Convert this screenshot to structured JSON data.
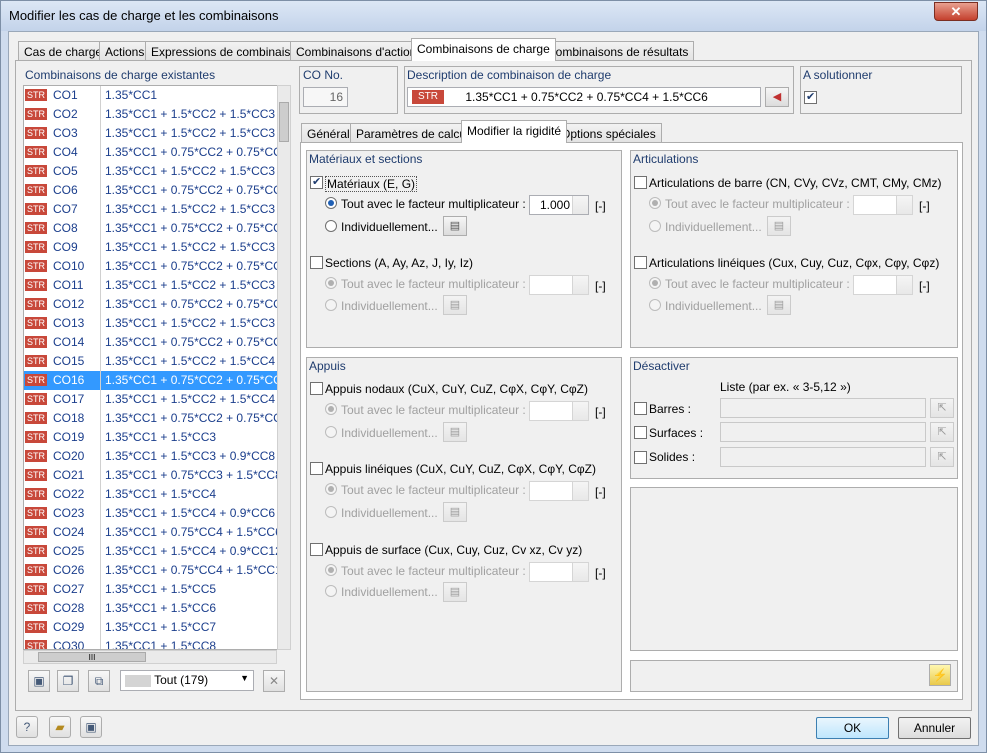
{
  "window": {
    "title": "Modifier les cas de charge et les combinaisons",
    "close": "✕"
  },
  "tabs": [
    "Cas de charge",
    "Actions",
    "Expressions de combinaison",
    "Combinaisons d'actions",
    "Combinaisons de charge",
    "Combinaisons de résultats"
  ],
  "list": {
    "title": "Combinaisons de charge existantes",
    "badge": "STR",
    "rows": [
      {
        "co": "CO1",
        "def": "1.35*CC1"
      },
      {
        "co": "CO2",
        "def": "1.35*CC1 + 1.5*CC2 + 1.5*CC3 + 1."
      },
      {
        "co": "CO3",
        "def": "1.35*CC1 + 1.5*CC2 + 1.5*CC3 + 1."
      },
      {
        "co": "CO4",
        "def": "1.35*CC1 + 0.75*CC2 + 0.75*CC3 +"
      },
      {
        "co": "CO5",
        "def": "1.35*CC1 + 1.5*CC2 + 1.5*CC3 + 1."
      },
      {
        "co": "CO6",
        "def": "1.35*CC1 + 0.75*CC2 + 0.75*CC3 +"
      },
      {
        "co": "CO7",
        "def": "1.35*CC1 + 1.5*CC2 + 1.5*CC3 + 1."
      },
      {
        "co": "CO8",
        "def": "1.35*CC1 + 0.75*CC2 + 0.75*CC3 +"
      },
      {
        "co": "CO9",
        "def": "1.35*CC1 + 1.5*CC2 + 1.5*CC3 + 1."
      },
      {
        "co": "CO10",
        "def": "1.35*CC1 + 0.75*CC2 + 0.75*CC3 +"
      },
      {
        "co": "CO11",
        "def": "1.35*CC1 + 1.5*CC2 + 1.5*CC3 + 1."
      },
      {
        "co": "CO12",
        "def": "1.35*CC1 + 0.75*CC2 + 0.75*CC3 +"
      },
      {
        "co": "CO13",
        "def": "1.35*CC1 + 1.5*CC2 + 1.5*CC3 + 0."
      },
      {
        "co": "CO14",
        "def": "1.35*CC1 + 0.75*CC2 + 0.75*CC3 +"
      },
      {
        "co": "CO15",
        "def": "1.35*CC1 + 1.5*CC2 + 1.5*CC4 + 0."
      },
      {
        "co": "CO16",
        "def": "1.35*CC1 + 0.75*CC2 + 0.75*CC4 +"
      },
      {
        "co": "CO17",
        "def": "1.35*CC1 + 1.5*CC2 + 1.5*CC4 + 0."
      },
      {
        "co": "CO18",
        "def": "1.35*CC1 + 0.75*CC2 + 0.75*CC4 +"
      },
      {
        "co": "CO19",
        "def": "1.35*CC1 + 1.5*CC3"
      },
      {
        "co": "CO20",
        "def": "1.35*CC1 + 1.5*CC3 + 0.9*CC8"
      },
      {
        "co": "CO21",
        "def": "1.35*CC1 + 0.75*CC3 + 1.5*CC8"
      },
      {
        "co": "CO22",
        "def": "1.35*CC1 + 1.5*CC4"
      },
      {
        "co": "CO23",
        "def": "1.35*CC1 + 1.5*CC4 + 0.9*CC6"
      },
      {
        "co": "CO24",
        "def": "1.35*CC1 + 0.75*CC4 + 1.5*CC6"
      },
      {
        "co": "CO25",
        "def": "1.35*CC1 + 1.5*CC4 + 0.9*CC12"
      },
      {
        "co": "CO26",
        "def": "1.35*CC1 + 0.75*CC4 + 1.5*CC12"
      },
      {
        "co": "CO27",
        "def": "1.35*CC1 + 1.5*CC5"
      },
      {
        "co": "CO28",
        "def": "1.35*CC1 + 1.5*CC6"
      },
      {
        "co": "CO29",
        "def": "1.35*CC1 + 1.5*CC7"
      },
      {
        "co": "CO30",
        "def": "1.35*CC1 + 1.5*CC8"
      }
    ],
    "selected_index": 15,
    "hscroll_grip": "III",
    "filter": "Tout (179)"
  },
  "header": {
    "co_label": "CO No.",
    "co_value": "16",
    "desc_label": "Description de combinaison de charge",
    "desc_badge": "STR",
    "desc_value": "1.35*CC1 + 0.75*CC2 + 0.75*CC4 + 1.5*CC6",
    "solve_label": "A solutionner",
    "solve_checked": true
  },
  "subtabs": [
    "Général",
    "Paramètres de calcul",
    "Modifier la rigidité",
    "Options spéciales"
  ],
  "materials": {
    "title": "Matériaux et sections",
    "mat_label": "Matériaux (E, G)",
    "mat_checked": true,
    "all_label": "Tout avec le facteur multiplicateur :",
    "mat_factor": "1.000",
    "unit": "[-]",
    "indiv_label": "Individuellement...",
    "sec_label": "Sections (A, Ay, Az, J, Iy, Iz)"
  },
  "articulations": {
    "title": "Articulations",
    "bar_label": "Articulations de barre (CN, CVy, CVz, CMT, CMy, CMz)",
    "line_label": "Articulations linéiques (Cux, Cuy, Cuz, Cφx, Cφy, Cφz)"
  },
  "supports": {
    "title": "Appuis",
    "nodal_label": "Appuis nodaux (CuX, CuY, CuZ, CφX, CφY, CφZ)",
    "line_label": "Appuis linéiques (CuX, CuY, CuZ, CφX, CφY, CφZ)",
    "surface_label": "Appuis de surface (Cux, Cuy, Cuz, Cv xz, Cv yz)"
  },
  "deactivate": {
    "title": "Désactiver",
    "list_label": "Liste (par ex. « 3-5,12 »)",
    "bars": "Barres :",
    "surfaces": "Surfaces :",
    "solids": "Solides :"
  },
  "footer": {
    "ok": "OK",
    "cancel": "Annuler"
  }
}
